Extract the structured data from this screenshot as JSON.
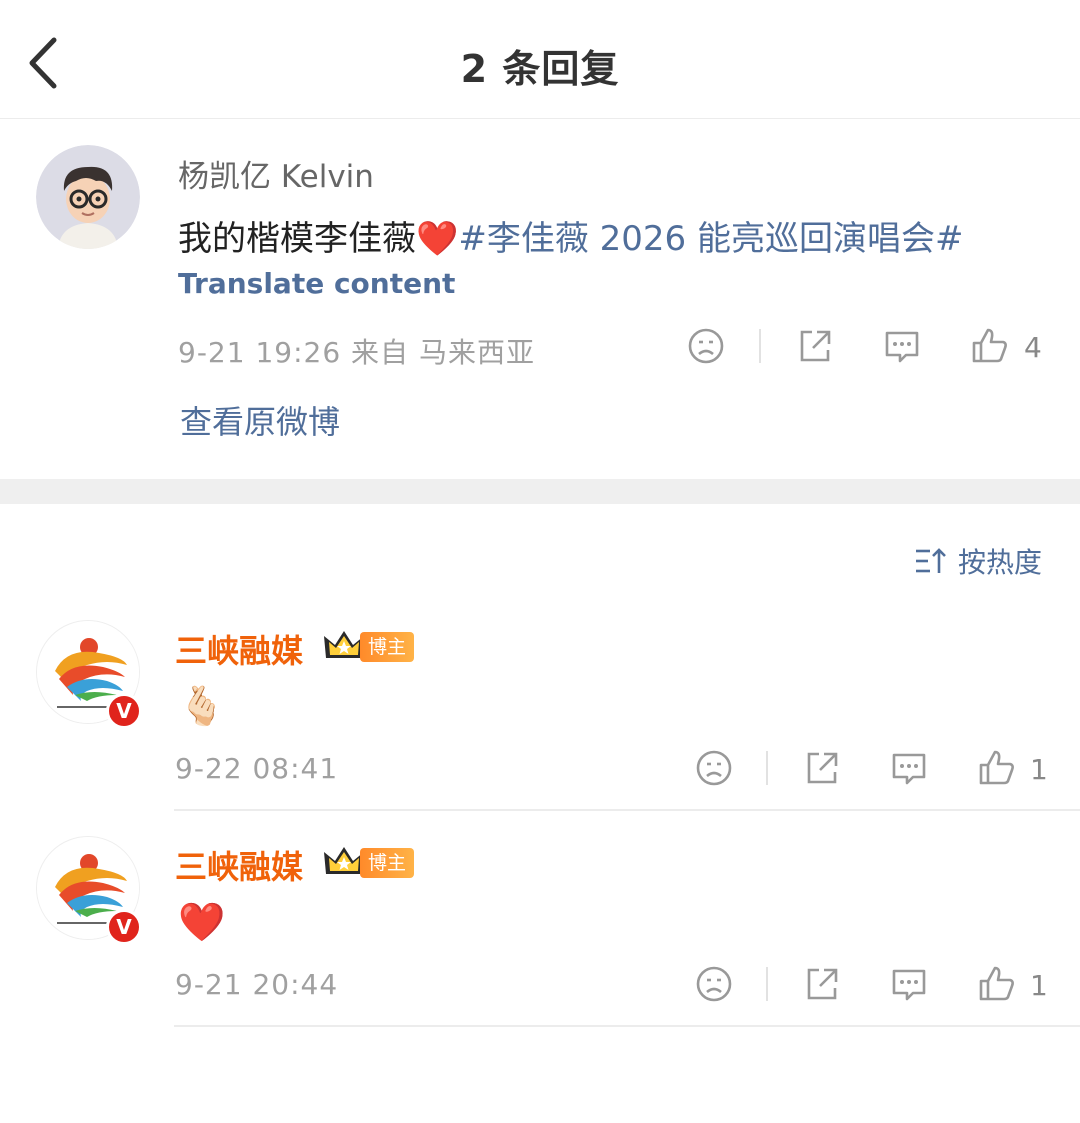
{
  "header": {
    "title": "2 条回复"
  },
  "main_comment": {
    "username": "杨凯亿 Kelvin",
    "text": "我的楷模李佳薇",
    "emoji": "❤️",
    "topic": "#李佳薇 2026 能亮巡回演唱会#",
    "translate_label": "Translate content",
    "meta": "9-21 19:26  来自 马来西亚",
    "likes": "4",
    "view_original_label": "查看原微博"
  },
  "sort": {
    "label": "按热度"
  },
  "replies": [
    {
      "username": "三峡融媒",
      "badge": "博主",
      "emoji": "🫰🏻",
      "meta": "9-22 08:41",
      "likes": "1"
    },
    {
      "username": "三峡融媒",
      "badge": "博主",
      "emoji": "❤️",
      "meta": "9-21 20:44",
      "likes": "1"
    }
  ],
  "colors": {
    "link_blue": "#506e9a",
    "accent_orange": "#f0620a",
    "meta_gray": "#a0a0a0"
  },
  "icons": [
    "back-arrow-icon",
    "dislike-face-icon",
    "share-icon",
    "comment-icon",
    "thumb-up-icon",
    "sort-icon",
    "crown-icon",
    "verified-v-icon"
  ]
}
